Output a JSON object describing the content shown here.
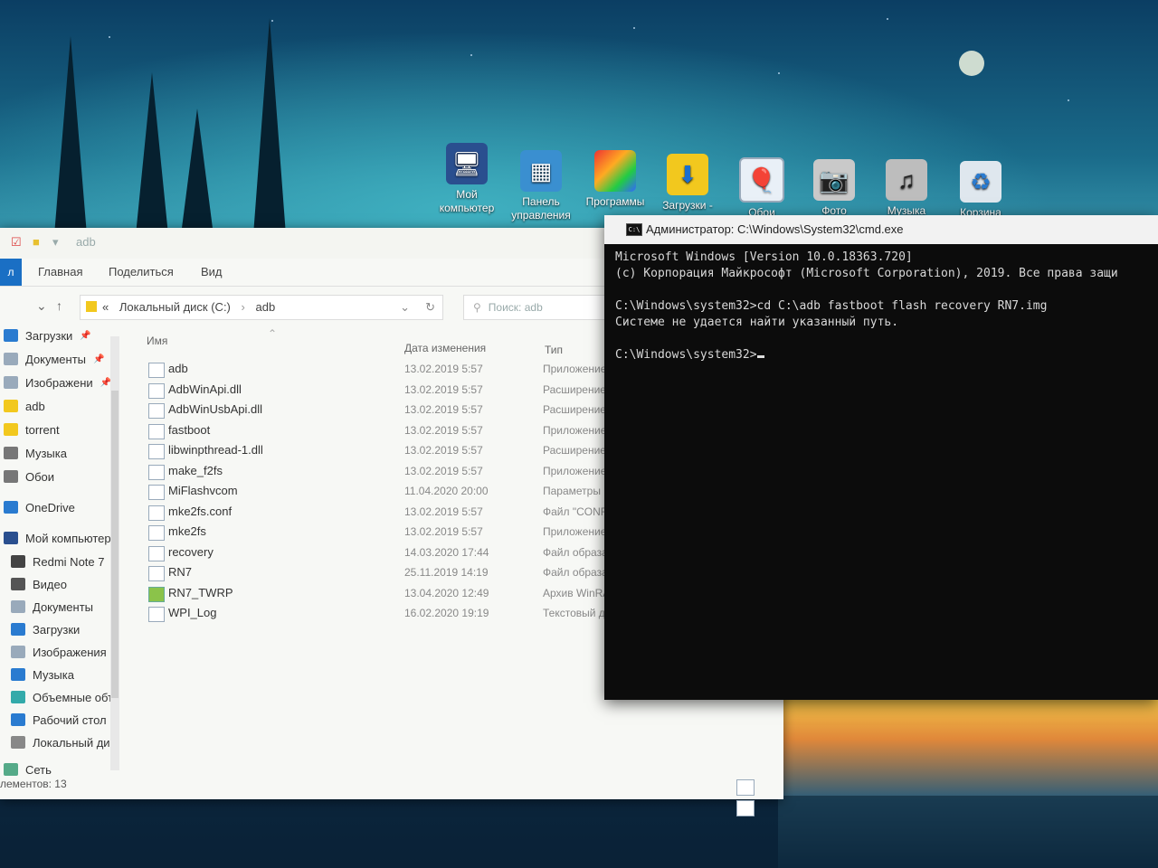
{
  "desktop": {
    "icons": [
      {
        "label_line1": "Мой",
        "label_line2": "компьютер",
        "icon": "monitor-icon"
      },
      {
        "label_line1": "Панель",
        "label_line2": "управления",
        "icon": "control-panel-icon"
      },
      {
        "label_line1": "Программы",
        "label_line2": "",
        "icon": "programs-icon"
      },
      {
        "label_line1": "Загрузки -",
        "label_line2": "",
        "icon": "downloads-folder-icon"
      },
      {
        "label_line1": "Обои",
        "label_line2": "",
        "icon": "wallpaper-icon"
      },
      {
        "label_line1": "Фото",
        "label_line2": "",
        "icon": "camera-icon"
      },
      {
        "label_line1": "Музыка",
        "label_line2": "",
        "icon": "music-speaker-icon"
      },
      {
        "label_line1": "Корзина",
        "label_line2": "",
        "icon": "recycle-bin-icon"
      }
    ]
  },
  "explorer": {
    "quick_access_path": "adb",
    "ribbon": {
      "file": "л",
      "home": "Главная",
      "share": "Поделиться",
      "view": "Вид"
    },
    "address": {
      "separator": "«",
      "drive": "Локальный диск (C:)",
      "arrow": "›",
      "folder": "adb"
    },
    "search_placeholder": "Поиск: adb",
    "nav": [
      {
        "label": "Загрузки",
        "pinned": true
      },
      {
        "label": "Документы",
        "pinned": true
      },
      {
        "label": "Изображени",
        "pinned": true
      },
      {
        "label": "adb",
        "pinned": false
      },
      {
        "label": "torrent",
        "pinned": false
      },
      {
        "label": "Музыка",
        "pinned": false
      },
      {
        "label": "Обои",
        "pinned": false
      },
      {
        "label": "OneDrive",
        "pinned": false
      },
      {
        "label": "Мой компьютер",
        "pinned": false
      },
      {
        "label": "Redmi Note 7",
        "pinned": false
      },
      {
        "label": "Видео",
        "pinned": false
      },
      {
        "label": "Документы",
        "pinned": false
      },
      {
        "label": "Загрузки",
        "pinned": false
      },
      {
        "label": "Изображения",
        "pinned": false
      },
      {
        "label": "Музыка",
        "pinned": false
      },
      {
        "label": "Объемные объ",
        "pinned": false
      },
      {
        "label": "Рабочий стол",
        "pinned": false
      },
      {
        "label": "Локальный дис",
        "pinned": false
      },
      {
        "label": "Сеть",
        "pinned": false
      }
    ],
    "columns": {
      "name": "Имя",
      "date": "Дата изменения",
      "type": "Тип"
    },
    "files": [
      {
        "name": "adb",
        "date": "13.02.2019 5:57",
        "type": "Приложение"
      },
      {
        "name": "AdbWinApi.dll",
        "date": "13.02.2019 5:57",
        "type": "Расширение"
      },
      {
        "name": "AdbWinUsbApi.dll",
        "date": "13.02.2019 5:57",
        "type": "Расширение"
      },
      {
        "name": "fastboot",
        "date": "13.02.2019 5:57",
        "type": "Приложение"
      },
      {
        "name": "libwinpthread-1.dll",
        "date": "13.02.2019 5:57",
        "type": "Расширение"
      },
      {
        "name": "make_f2fs",
        "date": "13.02.2019 5:57",
        "type": "Приложение"
      },
      {
        "name": "MiFlashvcom",
        "date": "11.04.2020 20:00",
        "type": "Параметры к"
      },
      {
        "name": "mke2fs.conf",
        "date": "13.02.2019 5:57",
        "type": "Файл \"CONF\""
      },
      {
        "name": "mke2fs",
        "date": "13.02.2019 5:57",
        "type": "Приложение"
      },
      {
        "name": "recovery",
        "date": "14.03.2020 17:44",
        "type": "Файл образа"
      },
      {
        "name": "RN7",
        "date": "25.11.2019 14:19",
        "type": "Файл образа"
      },
      {
        "name": "RN7_TWRP",
        "date": "13.04.2020 12:49",
        "type": "Архив WinRA"
      },
      {
        "name": "WPI_Log",
        "date": "16.02.2020 19:19",
        "type": "Текстовый до"
      }
    ],
    "status": "лементов: 13"
  },
  "cmd": {
    "title": "Администратор: C:\\Windows\\System32\\cmd.exe",
    "lines": [
      "Microsoft Windows [Version 10.0.18363.720]",
      "(c) Корпорация Майкрософт (Microsoft Corporation), 2019. Все права защи",
      "",
      "C:\\Windows\\system32>cd C:\\adb fastboot flash recovery RN7.img",
      "Системе не удается найти указанный путь.",
      "",
      "C:\\Windows\\system32>"
    ]
  }
}
